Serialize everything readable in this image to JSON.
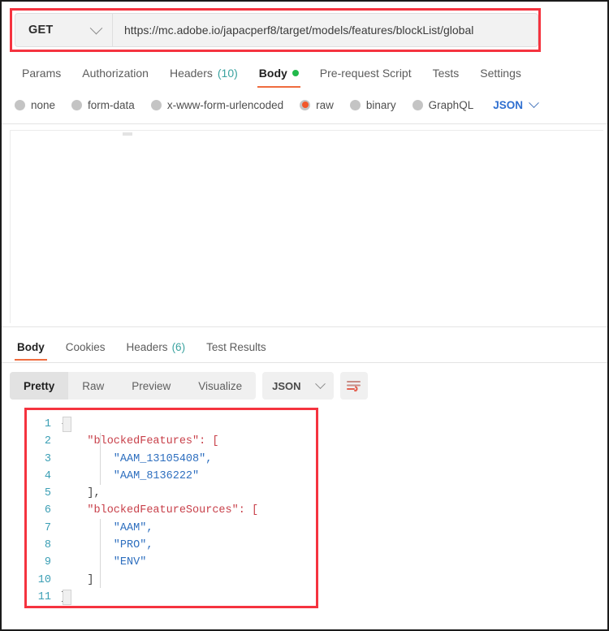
{
  "request": {
    "method": "GET",
    "url": "https://mc.adobe.io/japacperf8/target/models/features/blockList/global",
    "tabs": [
      {
        "label": "Params",
        "active": false
      },
      {
        "label": "Authorization",
        "active": false
      },
      {
        "label": "Headers",
        "count": "(10)",
        "active": false
      },
      {
        "label": "Body",
        "active": true,
        "dot": true
      },
      {
        "label": "Pre-request Script",
        "active": false
      },
      {
        "label": "Tests",
        "active": false
      },
      {
        "label": "Settings",
        "active": false
      }
    ],
    "body_types": [
      {
        "label": "none",
        "selected": false
      },
      {
        "label": "form-data",
        "selected": false
      },
      {
        "label": "x-www-form-urlencoded",
        "selected": false
      },
      {
        "label": "raw",
        "selected": true
      },
      {
        "label": "binary",
        "selected": false
      },
      {
        "label": "GraphQL",
        "selected": false
      }
    ],
    "body_format": "JSON"
  },
  "response": {
    "tabs": [
      {
        "label": "Body",
        "active": true
      },
      {
        "label": "Cookies",
        "active": false
      },
      {
        "label": "Headers",
        "count": "(6)",
        "active": false
      },
      {
        "label": "Test Results",
        "active": false
      }
    ],
    "view_modes": [
      {
        "label": "Pretty",
        "active": true
      },
      {
        "label": "Raw",
        "active": false
      },
      {
        "label": "Preview",
        "active": false
      },
      {
        "label": "Visualize",
        "active": false
      }
    ],
    "format": "JSON",
    "wrap_lines_icon": "wrap-lines-icon",
    "code_lines": [
      {
        "n": "1",
        "text": "{"
      },
      {
        "n": "2",
        "text": "    \"blockedFeatures\": ["
      },
      {
        "n": "3",
        "text": "        \"AAM_13105408\","
      },
      {
        "n": "4",
        "text": "        \"AAM_8136222\""
      },
      {
        "n": "5",
        "text": "    ],"
      },
      {
        "n": "6",
        "text": "    \"blockedFeatureSources\": ["
      },
      {
        "n": "7",
        "text": "        \"AAM\","
      },
      {
        "n": "8",
        "text": "        \"PRO\","
      },
      {
        "n": "9",
        "text": "        \"ENV\""
      },
      {
        "n": "10",
        "text": "    ]"
      },
      {
        "n": "11",
        "text": "}"
      }
    ]
  },
  "colors": {
    "accent_orange": "#ef6c3e",
    "radio_selected": "#f2572a",
    "annotation_red": "#f5333f",
    "json_blue": "#2f6fd0",
    "count_teal": "#3ba3a0",
    "status_green": "#21b94b"
  }
}
